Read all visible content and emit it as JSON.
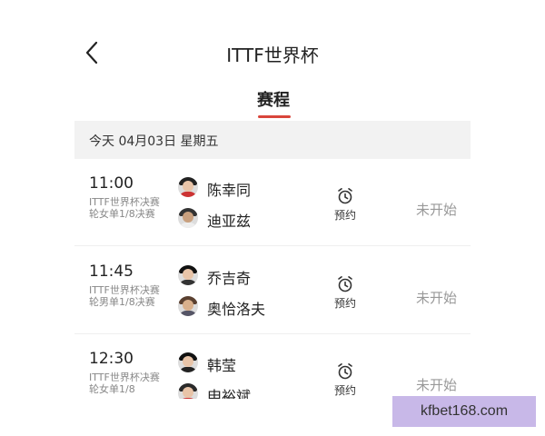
{
  "header": {
    "title": "ITTF世界杯"
  },
  "tabs": [
    {
      "label": "赛程"
    }
  ],
  "date_bar": "今天 04月03日 星期五",
  "matches": [
    {
      "time": "11:00",
      "event": "ITTF世界杯决赛轮女单1/8决赛",
      "players": [
        "陈幸同",
        "迪亚兹"
      ],
      "remind_label": "预约",
      "status": "未开始"
    },
    {
      "time": "11:45",
      "event": "ITTF世界杯决赛轮男单1/8决赛",
      "players": [
        "乔吉奇",
        "奥恰洛夫"
      ],
      "remind_label": "预约",
      "status": "未开始"
    },
    {
      "time": "12:30",
      "event": "ITTF世界杯决赛轮女单1/8",
      "players": [
        "韩莹",
        "申裕斌"
      ],
      "remind_label": "预约",
      "status": "未开始"
    }
  ],
  "icons": {
    "back": "chevron-left-icon",
    "remind": "alarm-clock-icon"
  },
  "colors": {
    "accent": "#d9453b",
    "date_bar_bg": "#f2f2f2",
    "muted_text": "#999999"
  },
  "watermark": "kfbet168.com"
}
